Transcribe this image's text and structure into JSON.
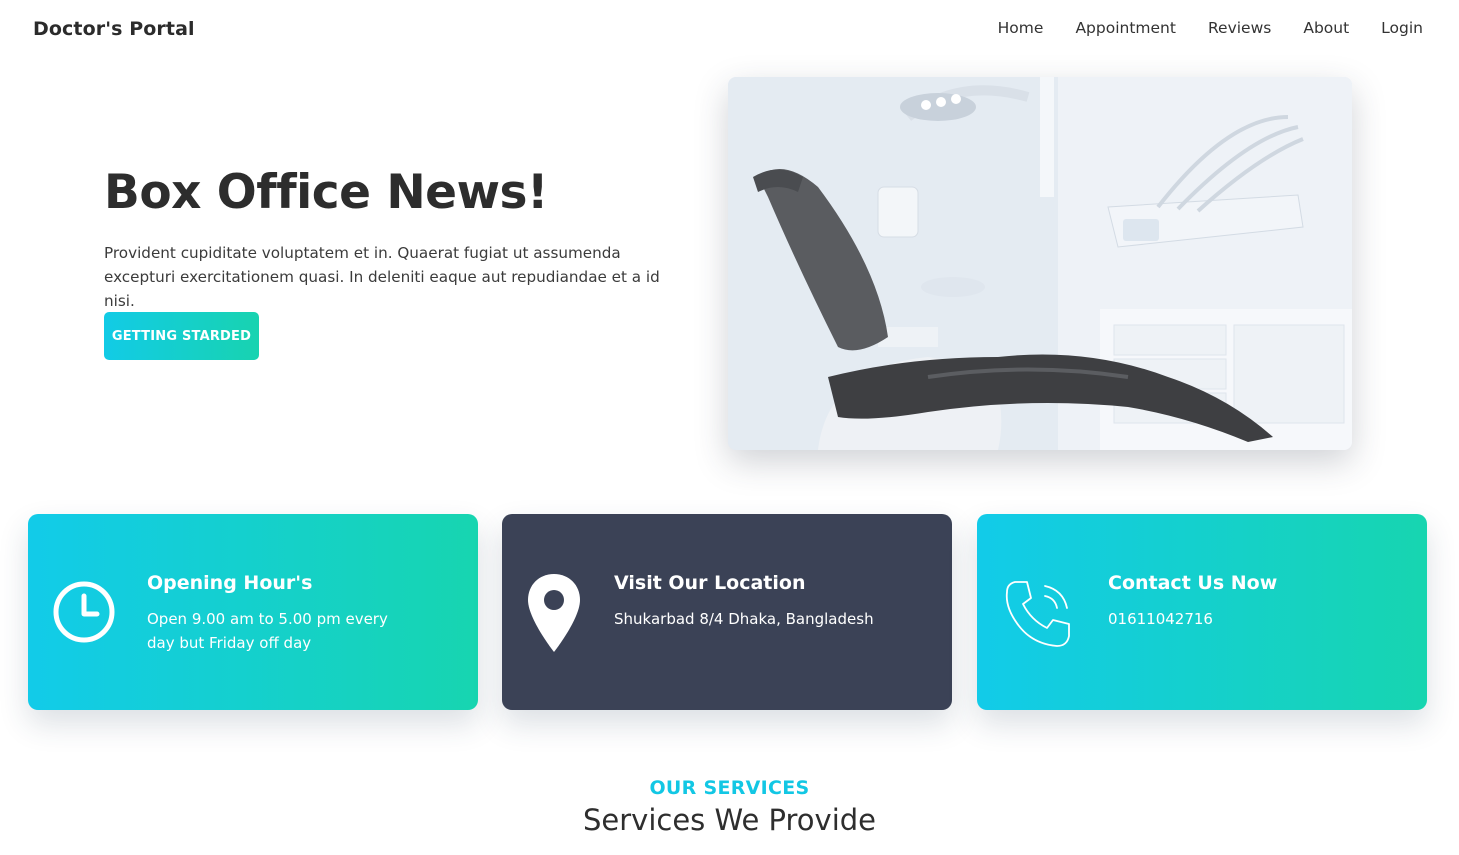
{
  "navbar": {
    "brand": "Doctor's Portal",
    "links": [
      "Home",
      "Appointment",
      "Reviews",
      "About",
      "Login"
    ]
  },
  "hero": {
    "title": "Box Office News!",
    "text": "Provident cupiditate voluptatem et in. Quaerat fugiat ut assumenda excepturi exercitationem quasi. In deleniti eaque aut repudiandae et a id nisi.",
    "button_label": "GETTING STARDED",
    "image_subject": "dental-chair-photo"
  },
  "cards": [
    {
      "icon": "clock-icon",
      "title": "Opening Hour's",
      "text": "Open 9.00 am to 5.00 pm every day but Friday off day"
    },
    {
      "icon": "location-pin-icon",
      "title": "Visit Our Location",
      "text": "Shukarbad 8/4 Dhaka, Bangladesh"
    },
    {
      "icon": "phone-icon",
      "title": "Contact Us Now",
      "text": "01611042716"
    }
  ],
  "services": {
    "kicker": "OUR SERVICES",
    "title": "Services We Provide"
  },
  "colors": {
    "accent_start": "#12cbe6",
    "accent_end": "#18d3b0",
    "dark_card": "#3b4256"
  }
}
